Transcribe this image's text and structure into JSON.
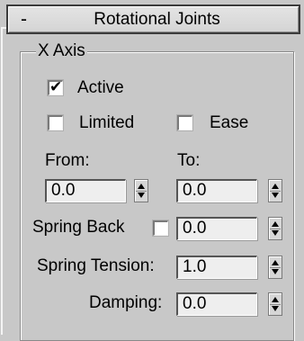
{
  "rollout": {
    "collapse_symbol": "-",
    "title": "Rotational Joints"
  },
  "x_axis": {
    "group_label": "X Axis",
    "active": {
      "label": "Active",
      "checked": true
    },
    "limited": {
      "label": "Limited",
      "checked": false
    },
    "ease": {
      "label": "Ease",
      "checked": false
    },
    "from": {
      "label": "From:",
      "value": "0.0"
    },
    "to": {
      "label": "To:",
      "value": "0.0"
    },
    "spring_back": {
      "label": "Spring Back",
      "checked": false,
      "value": "0.0"
    },
    "spring_tension": {
      "label": "Spring Tension:",
      "value": "1.0"
    },
    "damping": {
      "label": "Damping:",
      "value": "0.0"
    }
  },
  "icons": {
    "check": "✔",
    "spinner": "spinner-arrows-icon"
  }
}
